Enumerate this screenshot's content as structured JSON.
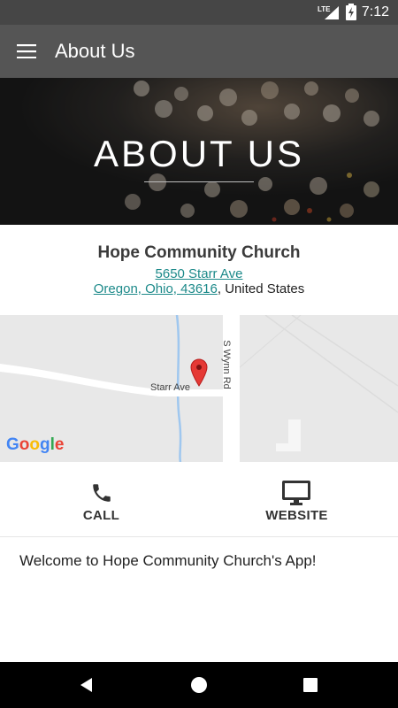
{
  "status_bar": {
    "network": "LTE",
    "time": "7:12"
  },
  "app_bar": {
    "title": "About Us"
  },
  "hero": {
    "title": "ABOUT US"
  },
  "church": {
    "name": "Hope Community Church",
    "street": "5650 Starr Ave",
    "city_line": "Oregon, Ohio, 43616",
    "country_suffix": ", United States"
  },
  "map": {
    "road_horizontal": "Starr Ave",
    "road_vertical": "S Wynn Rd",
    "google_letters": [
      "G",
      "o",
      "o",
      "g",
      "l",
      "e"
    ],
    "google_colors": [
      "#4285F4",
      "#EA4335",
      "#FBBC05",
      "#4285F4",
      "#34A853",
      "#EA4335"
    ]
  },
  "actions": {
    "call_label": "CALL",
    "website_label": "WEBSITE"
  },
  "welcome": "Welcome to Hope Community Church's App!",
  "colors": {
    "appbar": "#555555",
    "link": "#1d8a8a",
    "pin": "#e53935"
  }
}
